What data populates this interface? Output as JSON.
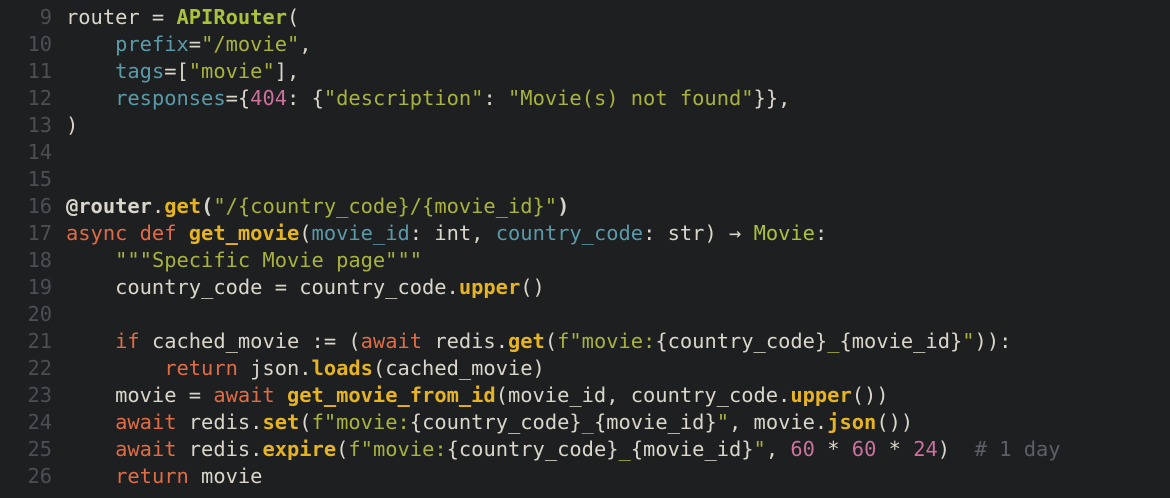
{
  "line_numbers": [
    "9",
    "10",
    "11",
    "12",
    "13",
    "14",
    "15",
    "16",
    "17",
    "18",
    "19",
    "20",
    "21",
    "22",
    "23",
    "24",
    "25",
    "26"
  ],
  "lines": [
    [
      [
        "id",
        "router = "
      ],
      [
        "cls",
        "APIRouter"
      ],
      [
        "punct",
        "("
      ]
    ],
    [
      [
        "id",
        "    "
      ],
      [
        "param",
        "prefix"
      ],
      [
        "punct",
        "="
      ],
      [
        "str",
        "\"/movie\""
      ],
      [
        "punct",
        ","
      ]
    ],
    [
      [
        "id",
        "    "
      ],
      [
        "param",
        "tags"
      ],
      [
        "punct",
        "=["
      ],
      [
        "str",
        "\"movie\""
      ],
      [
        "punct",
        "],"
      ]
    ],
    [
      [
        "id",
        "    "
      ],
      [
        "param",
        "responses"
      ],
      [
        "punct",
        "={"
      ],
      [
        "num",
        "404"
      ],
      [
        "punct",
        ": {"
      ],
      [
        "str",
        "\"description\""
      ],
      [
        "punct",
        ": "
      ],
      [
        "str",
        "\"Movie(s) not found\""
      ],
      [
        "punct",
        "}},"
      ]
    ],
    [
      [
        "punct",
        ")"
      ]
    ],
    [],
    [],
    [
      [
        "dec",
        "@router"
      ],
      [
        "punct",
        "."
      ],
      [
        "fn",
        "get"
      ],
      [
        "dec",
        "("
      ],
      [
        "str",
        "\"/{country_code}/{movie_id}\""
      ],
      [
        "dec",
        ")"
      ]
    ],
    [
      [
        "kw",
        "async def "
      ],
      [
        "fn",
        "get_movie"
      ],
      [
        "punct",
        "("
      ],
      [
        "param",
        "movie_id"
      ],
      [
        "punct",
        ": "
      ],
      [
        "type",
        "int"
      ],
      [
        "punct",
        ", "
      ],
      [
        "param",
        "country_code"
      ],
      [
        "punct",
        ": "
      ],
      [
        "type",
        "str"
      ],
      [
        "punct",
        ") → "
      ],
      [
        "ret",
        "Movie"
      ],
      [
        "punct",
        ":"
      ]
    ],
    [
      [
        "id",
        "    "
      ],
      [
        "str",
        "\"\"\"Specific Movie page\"\"\""
      ]
    ],
    [
      [
        "id",
        "    country_code = country_code."
      ],
      [
        "fn",
        "upper"
      ],
      [
        "punct",
        "()"
      ]
    ],
    [],
    [
      [
        "id",
        "    "
      ],
      [
        "kw",
        "if "
      ],
      [
        "id",
        "cached_movie := ("
      ],
      [
        "kw",
        "await "
      ],
      [
        "id",
        "redis."
      ],
      [
        "fn",
        "get"
      ],
      [
        "punct",
        "("
      ],
      [
        "str",
        "f\"movie:"
      ],
      [
        "punct",
        "{country_code}"
      ],
      [
        "str",
        "_"
      ],
      [
        "punct",
        "{movie_id}"
      ],
      [
        "str",
        "\""
      ],
      [
        "punct",
        "))"
      ],
      [
        "punct",
        ":"
      ]
    ],
    [
      [
        "id",
        "        "
      ],
      [
        "kw",
        "return "
      ],
      [
        "id",
        "json."
      ],
      [
        "fn",
        "loads"
      ],
      [
        "punct",
        "(cached_movie)"
      ]
    ],
    [
      [
        "id",
        "    movie = "
      ],
      [
        "kw",
        "await "
      ],
      [
        "fn",
        "get_movie_from_id"
      ],
      [
        "punct",
        "(movie_id, country_code."
      ],
      [
        "fn",
        "upper"
      ],
      [
        "punct",
        "())"
      ]
    ],
    [
      [
        "id",
        "    "
      ],
      [
        "kw",
        "await "
      ],
      [
        "id",
        "redis."
      ],
      [
        "fn",
        "set"
      ],
      [
        "punct",
        "("
      ],
      [
        "str",
        "f\"movie:"
      ],
      [
        "punct",
        "{country_code}"
      ],
      [
        "str",
        "_"
      ],
      [
        "punct",
        "{movie_id}"
      ],
      [
        "str",
        "\""
      ],
      [
        "punct",
        ", movie."
      ],
      [
        "fn",
        "json"
      ],
      [
        "punct",
        "())"
      ]
    ],
    [
      [
        "id",
        "    "
      ],
      [
        "kw",
        "await "
      ],
      [
        "id",
        "redis."
      ],
      [
        "fn",
        "expire"
      ],
      [
        "punct",
        "("
      ],
      [
        "str",
        "f\"movie:"
      ],
      [
        "punct",
        "{country_code}"
      ],
      [
        "str",
        "_"
      ],
      [
        "punct",
        "{movie_id}"
      ],
      [
        "str",
        "\""
      ],
      [
        "punct",
        ", "
      ],
      [
        "num",
        "60"
      ],
      [
        "punct",
        " * "
      ],
      [
        "num",
        "60"
      ],
      [
        "punct",
        " * "
      ],
      [
        "num",
        "24"
      ],
      [
        "punct",
        ")  "
      ],
      [
        "cmt",
        "# 1 day"
      ]
    ],
    [
      [
        "id",
        "    "
      ],
      [
        "kw",
        "return "
      ],
      [
        "id",
        "movie"
      ]
    ]
  ],
  "colors": {
    "background": "#1d1f21",
    "keyword": "#e06c44",
    "function": "#e6b422",
    "string": "#a8b23c",
    "parameter": "#5a9aa8",
    "number": "#c9719a",
    "comment": "#5c6066"
  }
}
